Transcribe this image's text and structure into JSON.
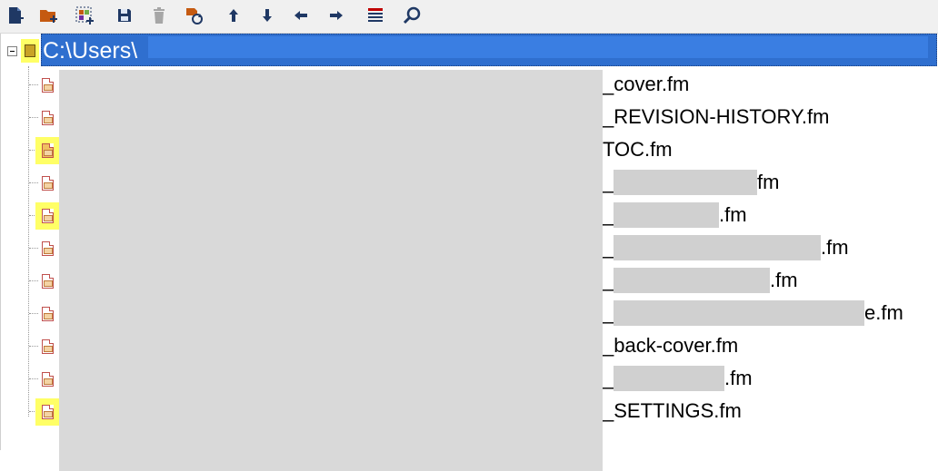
{
  "toolbar": {
    "buttons": [
      {
        "name": "new-file-icon",
        "color": "#1f3864"
      },
      {
        "name": "add-folder-icon",
        "color": "#c55a11"
      },
      {
        "name": "add-selection-icon",
        "color": "#7030a0"
      },
      {
        "name": "save-icon",
        "color": "#1f3864"
      },
      {
        "name": "delete-icon",
        "color": "#a6a6a6"
      },
      {
        "name": "refresh-icon",
        "color": "#c55a11"
      },
      {
        "name": "move-up-icon",
        "color": "#1f3864"
      },
      {
        "name": "move-down-icon",
        "color": "#1f3864"
      },
      {
        "name": "move-left-icon",
        "color": "#1f3864"
      },
      {
        "name": "move-right-icon",
        "color": "#1f3864"
      },
      {
        "name": "list-icon",
        "color": "#c00000"
      },
      {
        "name": "search-icon",
        "color": "#1f3864"
      }
    ]
  },
  "tree": {
    "root": {
      "label": "C:\\Users\\"
    },
    "files": [
      {
        "label": "_cover.fm",
        "highlight": false
      },
      {
        "label": "_REVISION-HISTORY.fm",
        "highlight": false
      },
      {
        "label": "TOC.fm",
        "highlight": true
      },
      {
        "label": "_",
        "suffix": "fm",
        "highlight": false
      },
      {
        "label": "_",
        "suffix": ".fm",
        "highlight": true
      },
      {
        "label": "_",
        "suffix": ".fm",
        "highlight": false
      },
      {
        "label": "_",
        "suffix": ".fm",
        "highlight": false
      },
      {
        "label": "_",
        "suffix": "e.fm",
        "highlight": false
      },
      {
        "label": "_back-cover.fm",
        "highlight": false
      },
      {
        "label": "_",
        "suffix": ".fm",
        "highlight": false
      },
      {
        "label": "_SETTINGS.fm",
        "highlight": true
      }
    ]
  },
  "colors": {
    "selection": "#2f6fcf",
    "highlight": "#ffff66"
  }
}
